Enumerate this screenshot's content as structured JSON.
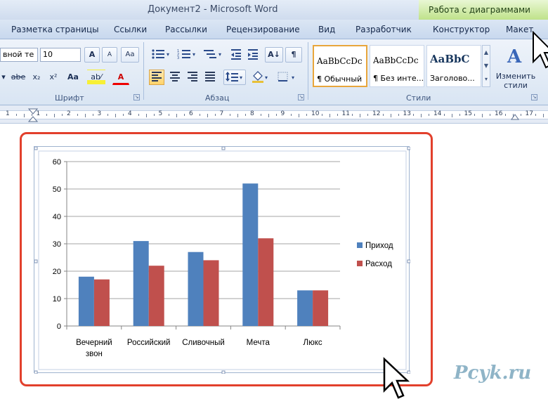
{
  "window": {
    "title": "Документ2 - Microsoft Word",
    "context_title": "Работа с диаграммами"
  },
  "tabs": [
    {
      "label": "Разметка страницы"
    },
    {
      "label": "Ссылки"
    },
    {
      "label": "Рассылки"
    },
    {
      "label": "Рецензирование"
    },
    {
      "label": "Вид"
    },
    {
      "label": "Разработчик"
    },
    {
      "label": "Конструктор"
    },
    {
      "label": "Макет"
    }
  ],
  "font_group": {
    "label": "Шрифт",
    "font_name": "вной те",
    "font_size": "10",
    "grow_font": "A",
    "shrink_font": "A",
    "clear_format": "Aa",
    "strike": "abe",
    "subscript": "x₂",
    "superscript": "x²",
    "change_case": "Aa",
    "highlight": "ab⁄",
    "font_color": "A"
  },
  "paragraph_group": {
    "label": "Абзац",
    "sort": "A↓",
    "pilcrow": "¶"
  },
  "styles_group": {
    "label": "Стили",
    "items": [
      {
        "sample": "AaBbCcDc",
        "name": "¶ Обычный"
      },
      {
        "sample": "AaBbCcDc",
        "name": "¶ Без инте..."
      },
      {
        "sample": "AaBbC",
        "name": "Заголово..."
      }
    ],
    "change_styles_label": "Изменить стили"
  },
  "ruler": {
    "numbers": [
      "1",
      "1",
      "2",
      "3",
      "4",
      "5",
      "6",
      "7",
      "8",
      "9",
      "10",
      "11",
      "12",
      "13",
      "14",
      "15",
      "16",
      "17"
    ]
  },
  "chart_data": {
    "type": "bar",
    "categories": [
      "Вечерний звон",
      "Российский",
      "Сливочный",
      "Мечта",
      "Люкс"
    ],
    "series": [
      {
        "name": "Приход",
        "values": [
          18,
          31,
          27,
          52,
          13
        ],
        "color": "#4f81bd"
      },
      {
        "name": "Расход",
        "values": [
          17,
          22,
          24,
          32,
          13
        ],
        "color": "#c0504d"
      }
    ],
    "ylim": [
      0,
      60
    ],
    "yticks": [
      0,
      10,
      20,
      30,
      40,
      50,
      60
    ],
    "grid": true,
    "legend": "right",
    "title": "",
    "xlabel": "",
    "ylabel": ""
  },
  "watermark": "Pcyk.ru",
  "colors": {
    "highlight_frame": "#e2402c",
    "context_band": "#bfe28a"
  }
}
